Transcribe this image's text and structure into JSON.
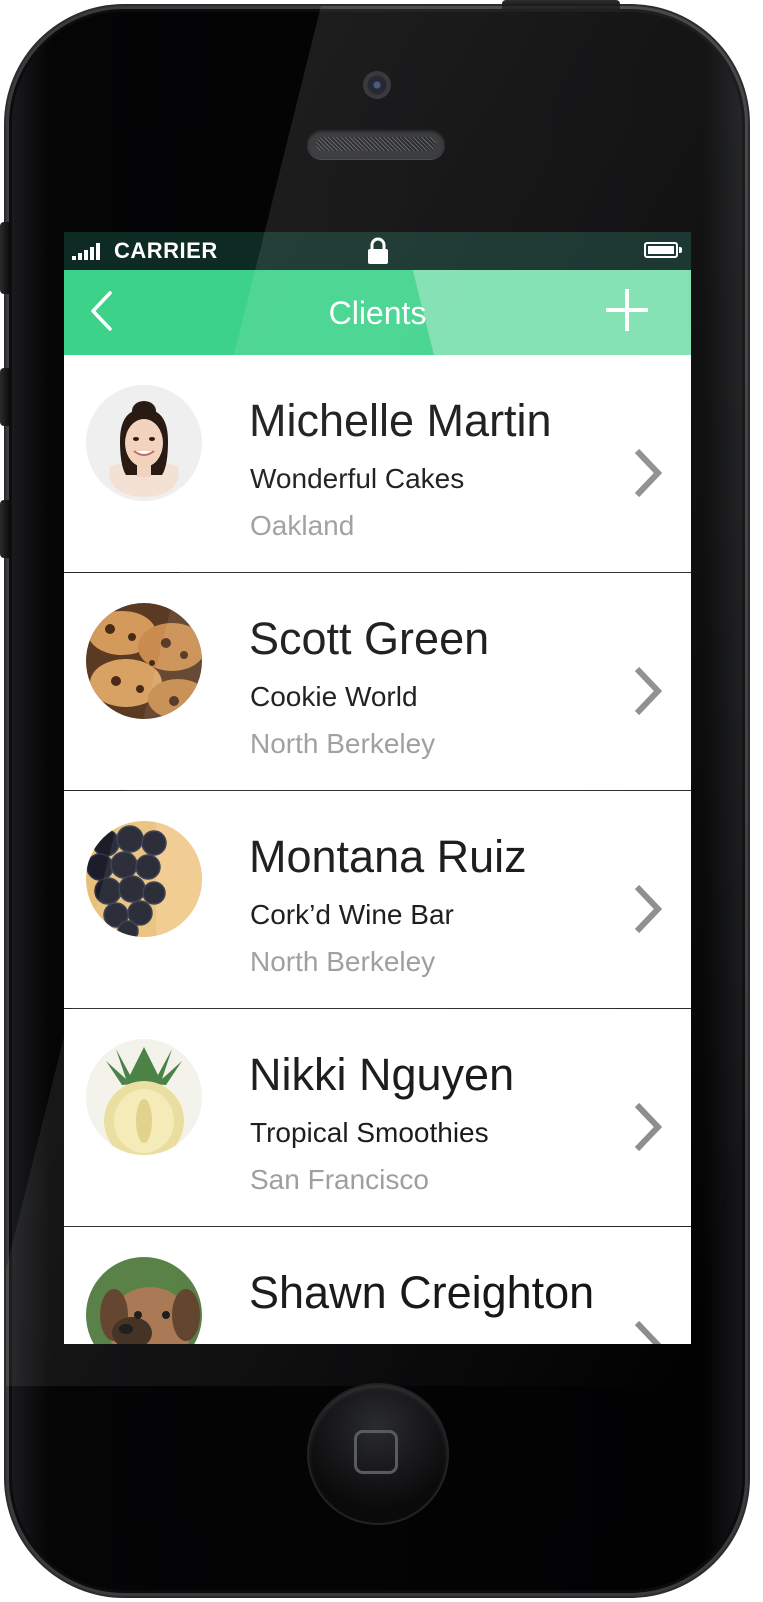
{
  "status_bar": {
    "carrier": "CARRIER",
    "signal_bars": 5
  },
  "nav_bar": {
    "title": "Clients",
    "back_icon": "chevron-left-icon",
    "add_icon": "plus-icon",
    "color": "#3dd28a"
  },
  "clients": [
    {
      "name": "Michelle Martin",
      "company": "Wonderful Cakes",
      "city": "Oakland",
      "avatar": "woman-portrait"
    },
    {
      "name": "Scott Green",
      "company": "Cookie World",
      "city": "North Berkeley",
      "avatar": "cookies"
    },
    {
      "name": "Montana Ruiz",
      "company": "Cork’d Wine Bar",
      "city": "North Berkeley",
      "avatar": "grapes"
    },
    {
      "name": "Nikki Nguyen",
      "company": "Tropical Smoothies",
      "city": "San Francisco",
      "avatar": "pineapple"
    },
    {
      "name": "Shawn Creighton",
      "company": "",
      "city": "",
      "avatar": "puppy"
    }
  ],
  "colors": {
    "accent": "#3dd28a",
    "status_bar": "#0d2a23",
    "secondary_text": "#9a9a9a",
    "chevron": "#8c8c8c"
  }
}
